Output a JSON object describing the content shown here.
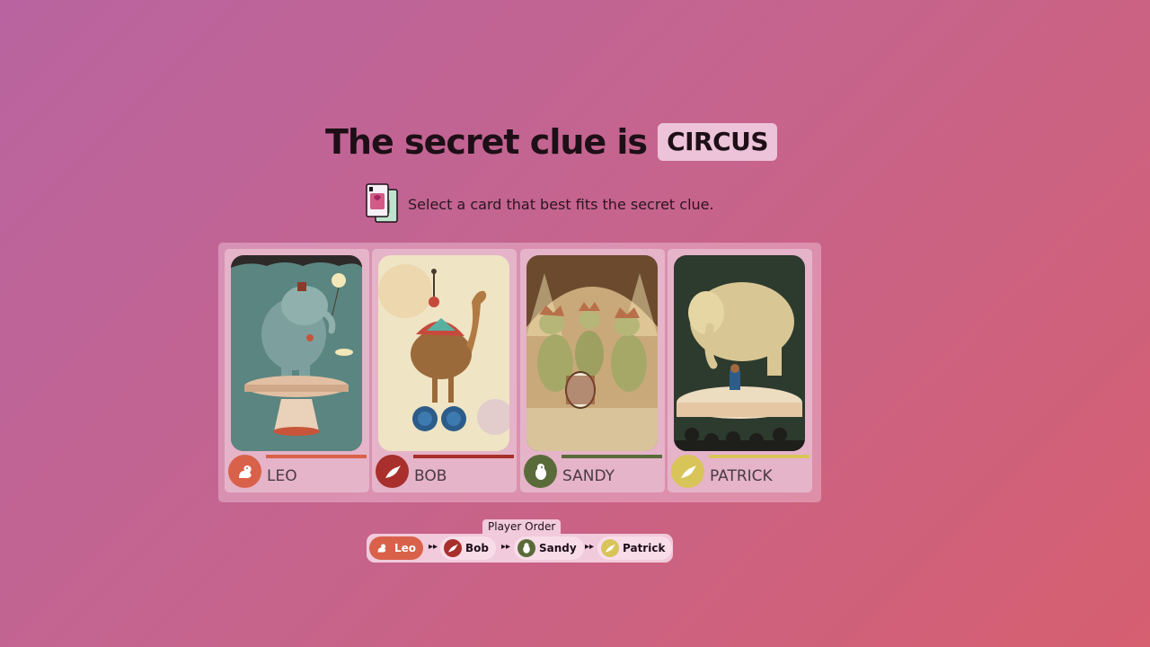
{
  "header": {
    "title": "The secret clue is",
    "clue": "CIRCUS"
  },
  "instruction": {
    "text": "Select a card that best fits the secret clue.",
    "icon": "playing-cards-icon"
  },
  "cards": [
    {
      "player": "LEO",
      "color": "#d9614a",
      "icon": "squirrel-icon",
      "art": "elephant on pedestal with balloon"
    },
    {
      "player": "BOB",
      "color": "#a82f2c",
      "icon": "bird-icon",
      "art": "camel on unicycle"
    },
    {
      "player": "SANDY",
      "color": "#5a6b3a",
      "icon": "beaver-icon",
      "art": "dinosaur band"
    },
    {
      "player": "PATRICK",
      "color": "#d9c45a",
      "icon": "bird-icon",
      "art": "elephant with crowd"
    }
  ],
  "player_order": {
    "label": "Player Order",
    "players": [
      {
        "name": "Leo",
        "color": "#d9614a",
        "icon": "squirrel-icon"
      },
      {
        "name": "Bob",
        "color": "#a82f2c",
        "icon": "bird-icon"
      },
      {
        "name": "Sandy",
        "color": "#5a6b3a",
        "icon": "beaver-icon"
      },
      {
        "name": "Patrick",
        "color": "#d9c45a",
        "icon": "bird-icon"
      }
    ],
    "separator_icon": "double-arrow-icon"
  }
}
